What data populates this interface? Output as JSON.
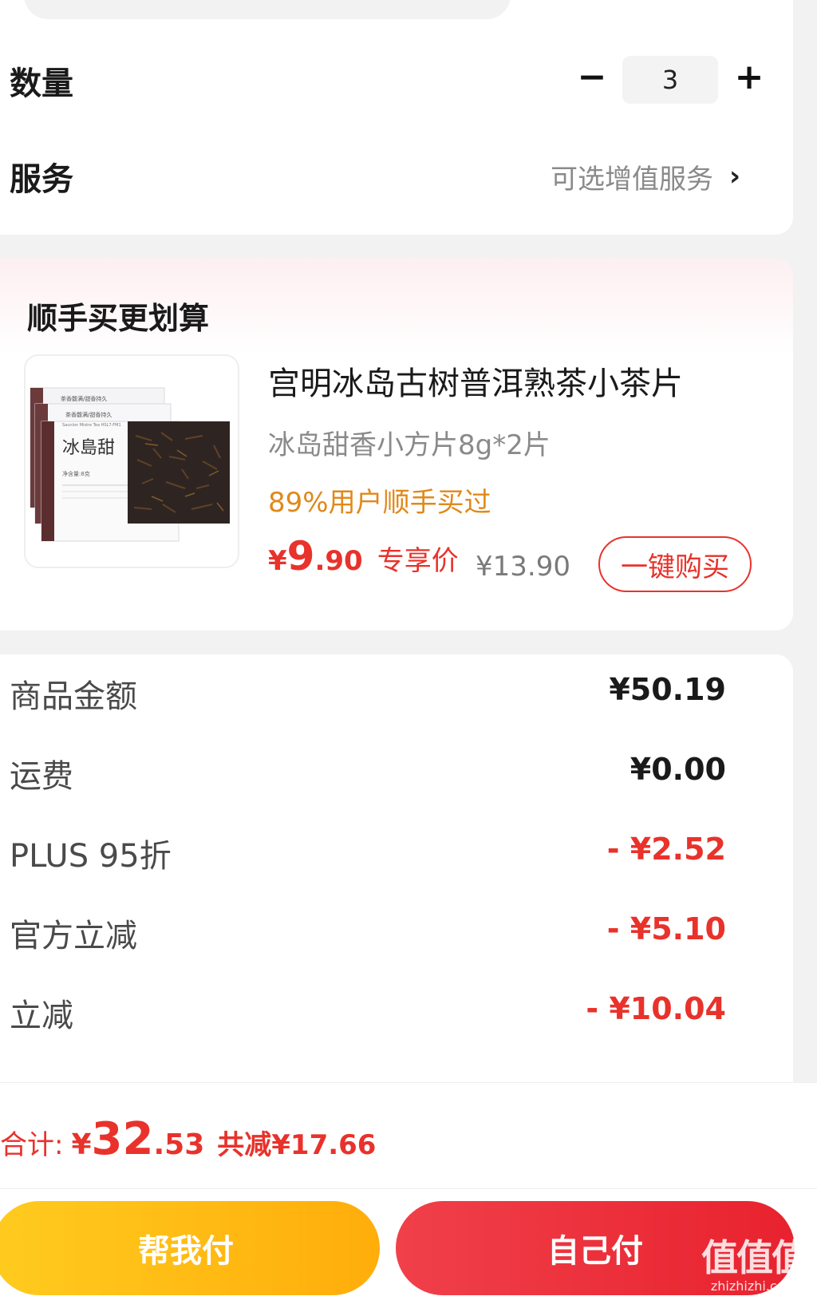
{
  "quantity": {
    "label": "数量",
    "minus": "−",
    "value": "3",
    "plus": "+"
  },
  "service": {
    "label": "服务",
    "link_text": "可选增值服务",
    "chevron": "›"
  },
  "bundle": {
    "title": "顺手买更划算",
    "product_name": "宫明冰岛古树普洱熟茶小茶片",
    "spec": "冰岛甜香小方片8g*2片",
    "tip": "89%用户顺手买过",
    "price_symbol": "¥",
    "price_int": "9",
    "price_dec": ".90",
    "price_tag": "专享价",
    "original_price": "¥13.90",
    "buy_button": "一键购买",
    "image": {
      "box_text_1": "茶香馥满/甜香持久",
      "box_text_2": "茶香馥满/甜香持久",
      "box_text_3": "Saunlon Mistre Tea HSL7-FM1",
      "box_name": "冰島甜",
      "box_weight": "净含量:8克"
    }
  },
  "amounts": [
    {
      "label": "商品金额",
      "value": "¥50.19",
      "negative": false
    },
    {
      "label": "运费",
      "value": "¥0.00",
      "negative": false
    },
    {
      "label": "PLUS 95折",
      "value": "- ¥2.52",
      "negative": true
    },
    {
      "label": "官方立减",
      "value": "- ¥5.10",
      "negative": true
    },
    {
      "label": "立减",
      "value": "- ¥10.04",
      "negative": true
    }
  ],
  "total": {
    "label": "合计:",
    "symbol": "¥",
    "int": "32",
    "dec": ".53",
    "saved": "共减¥17.66"
  },
  "buttons": {
    "help_pay": "帮我付",
    "self_pay": "自己付"
  },
  "watermark": {
    "logo": "值值值",
    "url": "zhizhizhi.com"
  },
  "colors": {
    "accent_red": "#e8322b",
    "tip_orange": "#e0891a",
    "help_button": "#ffbb12",
    "self_button": "#ec2f38"
  }
}
